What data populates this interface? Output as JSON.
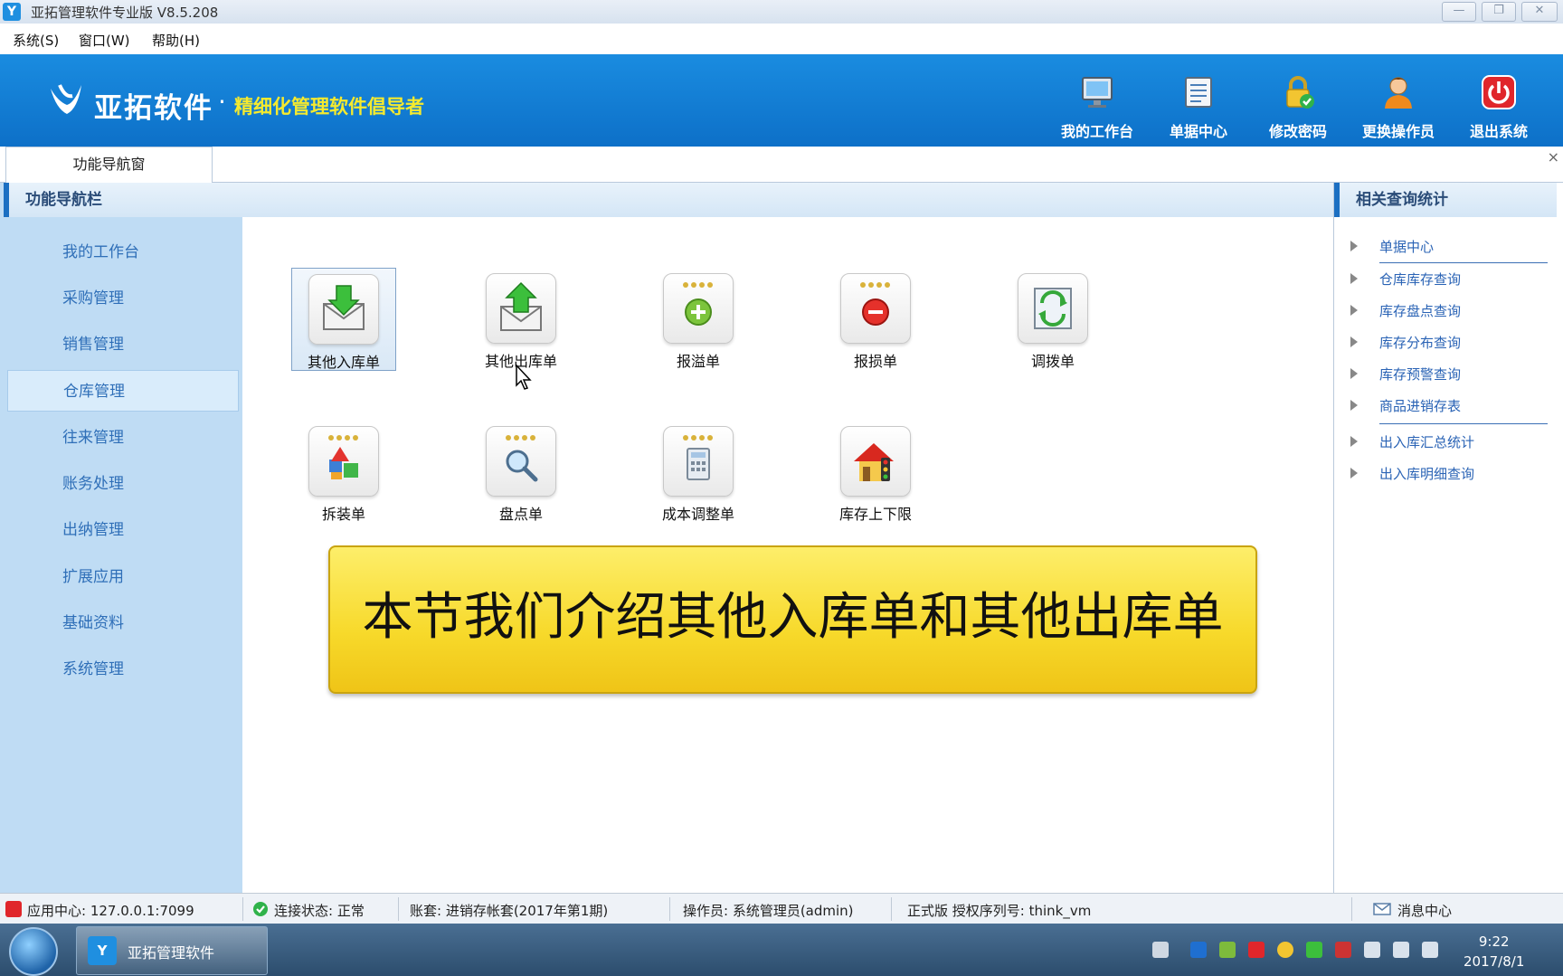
{
  "window": {
    "title": "亚拓管理软件专业版 V8.5.208",
    "min": "—",
    "restore": "❐",
    "close": "✕"
  },
  "menu": [
    "系统(S)",
    "窗口(W)",
    "帮助(H)"
  ],
  "header": {
    "brand": "亚拓软件",
    "dot": "·",
    "slogan": "精细化管理软件倡导者",
    "buttons": [
      {
        "label": "我的工作台",
        "icon": "monitor-icon"
      },
      {
        "label": "单据中心",
        "icon": "document-list-icon"
      },
      {
        "label": "修改密码",
        "icon": "lock-icon"
      },
      {
        "label": "更换操作员",
        "icon": "user-icon"
      },
      {
        "label": "退出系统",
        "icon": "power-icon"
      }
    ]
  },
  "tabs": {
    "active": "功能导航窗",
    "close": "×"
  },
  "leftnav": {
    "title": "功能导航栏",
    "items": [
      "我的工作台",
      "采购管理",
      "销售管理",
      "仓库管理",
      "往来管理",
      "账务处理",
      "出纳管理",
      "扩展应用",
      "基础资料",
      "系统管理"
    ],
    "active_index": 3
  },
  "functions": [
    {
      "label": "其他入库单",
      "icon": "inbound-icon"
    },
    {
      "label": "其他出库单",
      "icon": "outbound-icon"
    },
    {
      "label": "报溢单",
      "icon": "overflow-icon"
    },
    {
      "label": "报损单",
      "icon": "loss-icon"
    },
    {
      "label": "调拨单",
      "icon": "transfer-icon"
    },
    {
      "label": "拆装单",
      "icon": "assembly-icon"
    },
    {
      "label": "盘点单",
      "icon": "stocktake-icon"
    },
    {
      "label": "成本调整单",
      "icon": "cost-adjust-icon"
    },
    {
      "label": "库存上下限",
      "icon": "stock-limit-icon"
    }
  ],
  "banner": "本节我们介绍其他入库单和其他出库单",
  "rightpanel": {
    "title": "相关查询统计",
    "links": [
      "单据中心",
      "仓库库存查询",
      "库存盘点查询",
      "库存分布查询",
      "库存预警查询",
      "商品进销存表",
      "出入库汇总统计",
      "出入库明细查询"
    ]
  },
  "status": {
    "app_center": "应用中心: 127.0.0.1:7099",
    "connection": "连接状态: 正常",
    "account": "账套: 进销存帐套(2017年第1期)",
    "operator": "操作员: 系统管理员(admin)",
    "license": "正式版 授权序列号: think_vm",
    "messages": "消息中心"
  },
  "taskbar": {
    "app": "亚拓管理软件",
    "time": "9:22",
    "date": "2017/8/1"
  }
}
